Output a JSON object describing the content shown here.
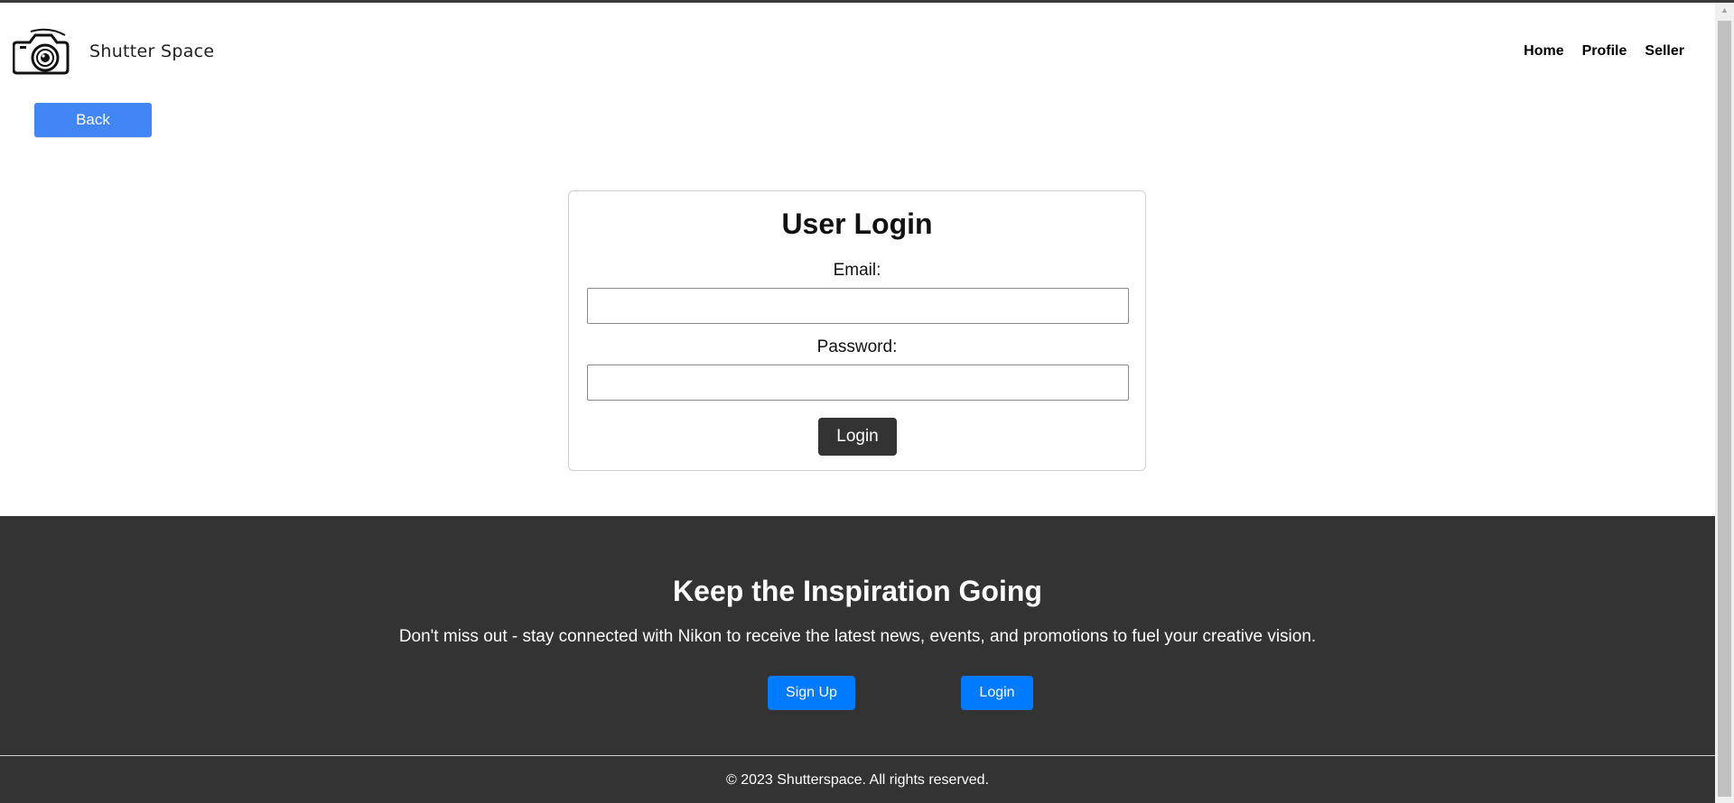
{
  "header": {
    "brand": "Shutter Space",
    "nav": [
      "Home",
      "Profile",
      "Seller"
    ],
    "logo_icon": "camera-logo-icon"
  },
  "back_button": "Back",
  "login_card": {
    "title": "User Login",
    "email_label": "Email:",
    "email_value": "",
    "password_label": "Password:",
    "password_value": "",
    "submit_label": "Login"
  },
  "footer": {
    "title": "Keep the Inspiration Going",
    "text": "Don't miss out - stay connected with Nikon to receive the latest news, events, and promotions to fuel your creative vision.",
    "signup_label": "Sign Up",
    "login_label": "Login",
    "copyright": "© 2023 Shutterspace. All rights reserved."
  },
  "colors": {
    "primary_blue": "#4285f4",
    "footer_button_blue": "#007bff",
    "dark": "#333333"
  }
}
